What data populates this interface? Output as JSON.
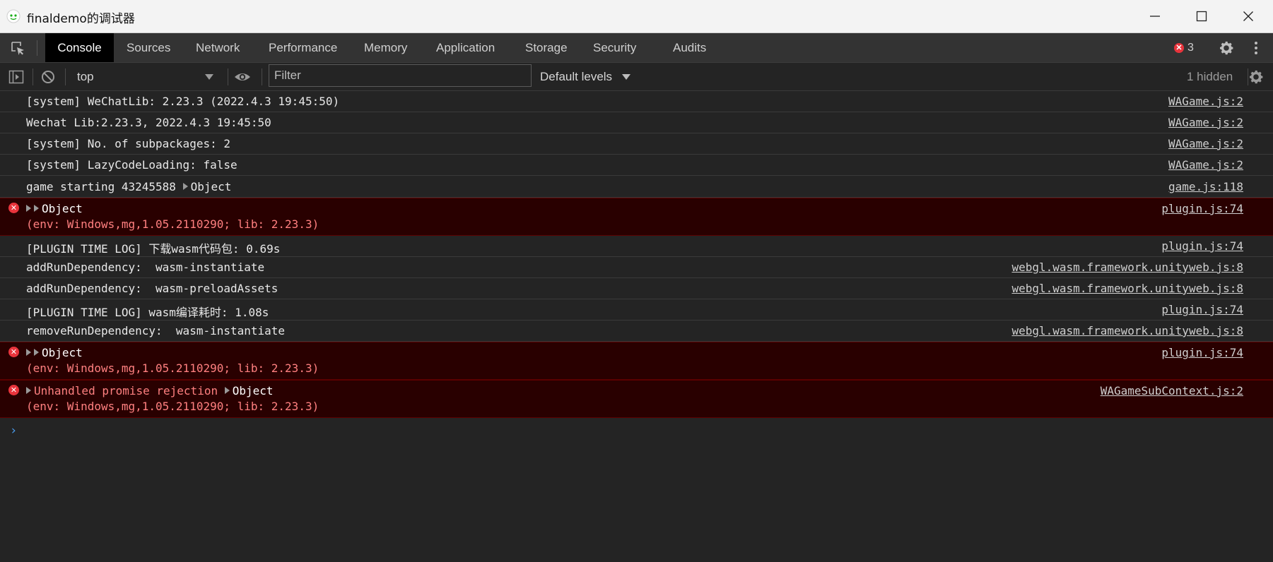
{
  "window": {
    "title": "finaldemo的调试器",
    "minimize_icon": "minimize-icon",
    "maximize_icon": "maximize-icon",
    "close_icon": "close-icon"
  },
  "tabs": [
    "Console",
    "Sources",
    "Network",
    "Performance",
    "Memory",
    "Application",
    "Storage",
    "Security",
    "Audits"
  ],
  "active_tab": "Console",
  "toolbar": {
    "error_count": "3",
    "error_count_icon": "error-icon",
    "settings_icon": "gear-icon",
    "more_icon": "kebab-icon"
  },
  "filterbar": {
    "context": "top",
    "filter_placeholder": "Filter",
    "levels": "Default levels",
    "hidden": "1 hidden"
  },
  "colors": {
    "background": "#242424",
    "toolbar": "#333333",
    "error_background": "#290000",
    "error_text": "#ff8080",
    "prompt": "#4a9ef0"
  },
  "messages": [
    {
      "text": "[system] WeChatLib: 2.23.3 (2022.4.3 19:45:50)",
      "source": "WAGame.js:2"
    },
    {
      "text": "Wechat Lib:2.23.3, 2022.4.3 19:45:50",
      "source": "WAGame.js:2"
    },
    {
      "text": "[system] No. of subpackages: 2",
      "source": "WAGame.js:2"
    },
    {
      "text": "[system] LazyCodeLoading: false",
      "source": "WAGame.js:2"
    },
    {
      "text": "game starting 43245588",
      "object": "Object",
      "source": "game.js:118"
    },
    {
      "object": "Object",
      "sub": "(env: Windows,mg,1.05.2110290; lib: 2.23.3)",
      "source": "plugin.js:74",
      "level": "error"
    },
    {
      "text": "[PLUGIN TIME LOG] 下载wasm代码包: 0.69s",
      "source": "plugin.js:74"
    },
    {
      "text": "addRunDependency:  wasm-instantiate",
      "source": "webgl.wasm.framework.unityweb.js:8"
    },
    {
      "text": "addRunDependency:  wasm-preloadAssets",
      "source": "webgl.wasm.framework.unityweb.js:8"
    },
    {
      "text": "[PLUGIN TIME LOG] wasm编译耗时: 1.08s",
      "source": "plugin.js:74"
    },
    {
      "text": "removeRunDependency:  wasm-instantiate",
      "source": "webgl.wasm.framework.unityweb.js:8"
    },
    {
      "object": "Object",
      "sub": "(env: Windows,mg,1.05.2110290; lib: 2.23.3)",
      "source": "plugin.js:74",
      "level": "error"
    },
    {
      "text": "Unhandled promise rejection",
      "object": "Object",
      "sub": "(env: Windows,mg,1.05.2110290; lib: 2.23.3)",
      "source": "WAGameSubContext.js:2",
      "level": "error"
    }
  ]
}
